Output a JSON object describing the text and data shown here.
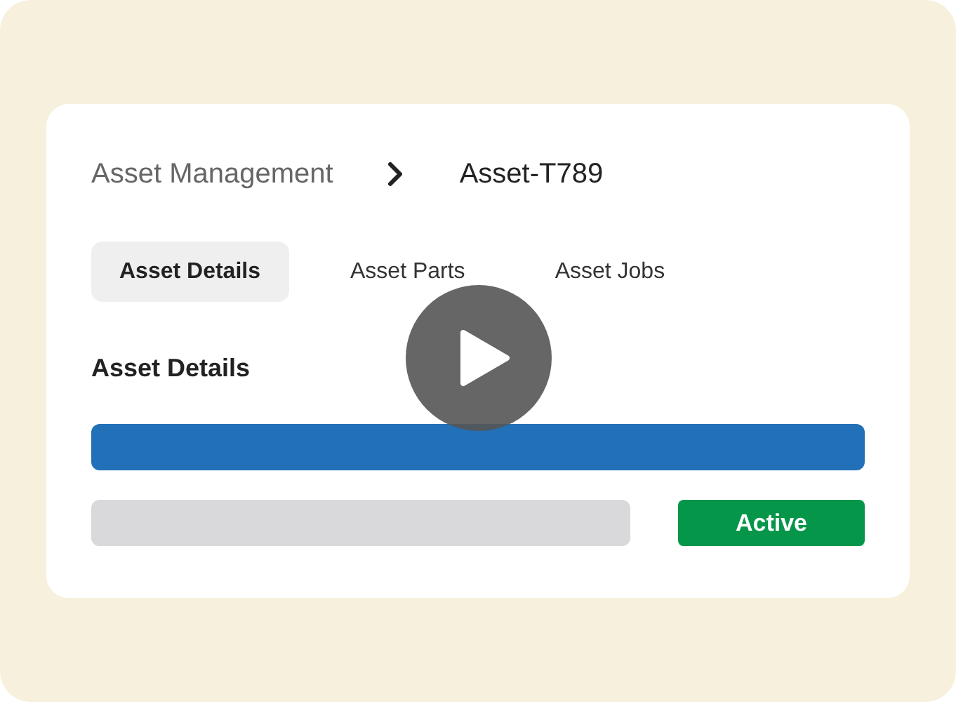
{
  "breadcrumb": [
    "Asset Management",
    "Asset-T789"
  ],
  "tabs": [
    {
      "label": "Asset Details",
      "selected": true
    },
    {
      "label": "Asset Parts",
      "selected": false
    },
    {
      "label": "Asset Jobs",
      "selected": false
    }
  ],
  "section_title": "Asset Details",
  "status": "Active"
}
